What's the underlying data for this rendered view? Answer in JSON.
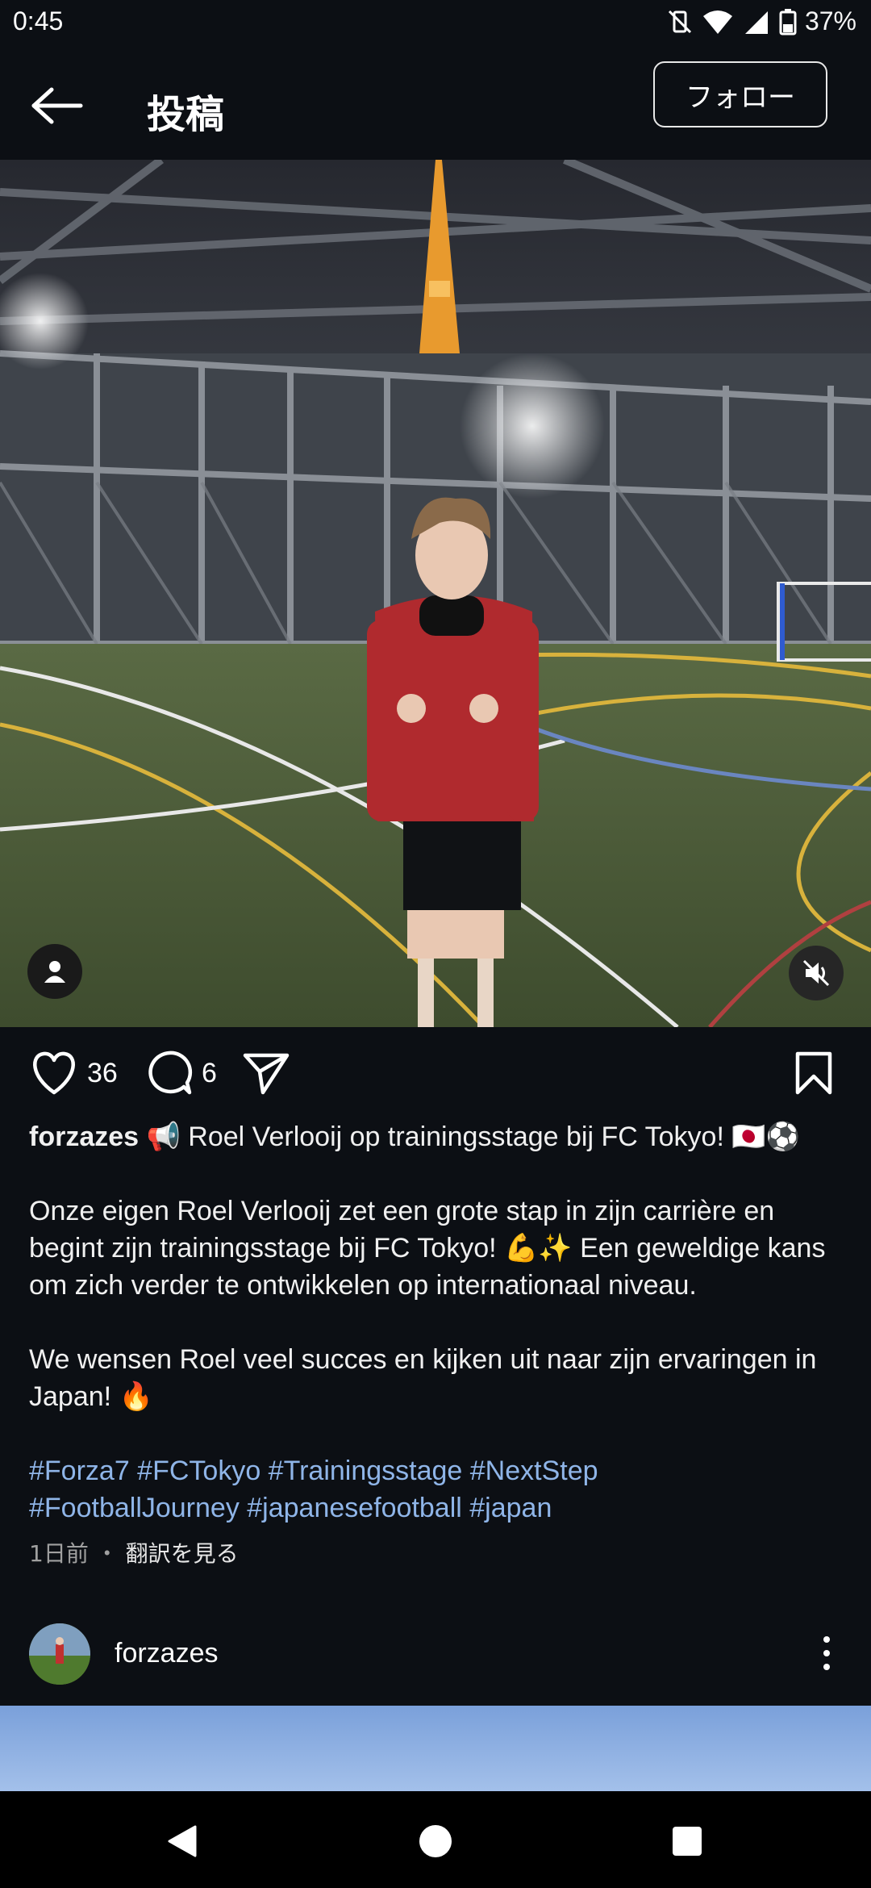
{
  "status_bar": {
    "time": "0:45",
    "battery": "37%"
  },
  "header": {
    "title": "投稿",
    "follow_label": "フォロー"
  },
  "post": {
    "likes": "36",
    "comments": "6",
    "username": "forzazes",
    "headline": "📢 Roel Verlooij op trainingsstage bij FC Tokyo! 🇯🇵⚽",
    "paragraph1": "Onze eigen Roel Verlooij zet een grote stap in zijn carrière en begint zijn trainingsstage bij FC Tokyo! 💪✨ Een geweldige kans om zich verder te ontwikkelen op internationaal niveau.",
    "paragraph2": "We wensen Roel veel succes en kijken uit naar zijn ervaringen in Japan! 🔥",
    "hashtags_line1": "#Forza7 #FCTokyo #Trainingsstage #NextStep",
    "hashtags_line2": "#FootballJourney #japanesefootball #japan",
    "time_ago": "1日前",
    "separator": " ・ ",
    "translate_label": "翻訳を見る"
  },
  "next_post": {
    "username": "forzazes"
  },
  "colors": {
    "background": "#0c0f14",
    "hashtag": "#8fb5e8",
    "meta": "#a0a0a0"
  },
  "icons": [
    "back-arrow-icon",
    "heart-icon",
    "comment-icon",
    "share-icon",
    "bookmark-icon",
    "user-tag-icon",
    "mute-icon",
    "more-icon",
    "nav-back-icon",
    "nav-home-icon",
    "nav-recents-icon"
  ]
}
